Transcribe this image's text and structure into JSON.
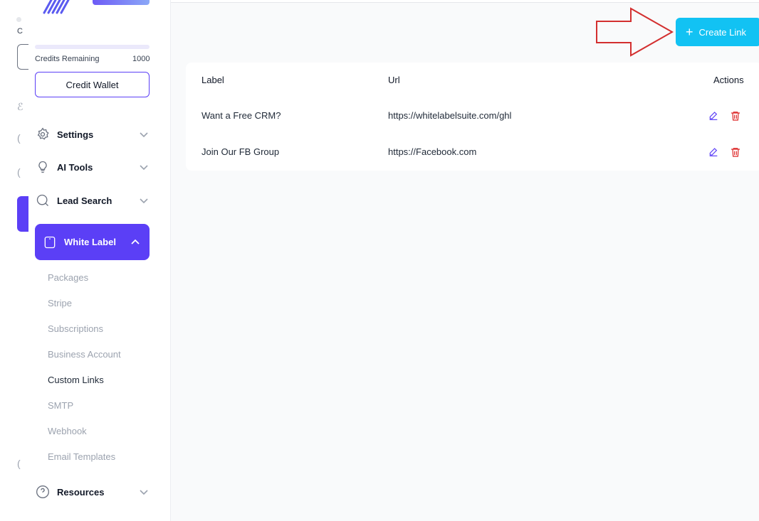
{
  "rail": {
    "letter": "C"
  },
  "sidebar": {
    "credits_label": "Credits Remaining",
    "credits_value": "1000",
    "credit_wallet_label": "Credit Wallet",
    "nav": [
      {
        "label": "Settings",
        "icon": "gear-icon"
      },
      {
        "label": "AI Tools",
        "icon": "lightbulb-icon"
      },
      {
        "label": "Lead Search",
        "icon": "search-icon"
      },
      {
        "label": "White Label",
        "icon": "tablet-icon",
        "active": true
      },
      {
        "label": "Resources",
        "icon": "help-circle-icon"
      }
    ],
    "sub_items": [
      "Packages",
      "Stripe",
      "Subscriptions",
      "Business Account",
      "Custom Links",
      "SMTP",
      "Webhook",
      "Email Templates"
    ],
    "current_sub": "Custom Links"
  },
  "main": {
    "create_button_label": "Create Link",
    "table": {
      "headers": {
        "label": "Label",
        "url": "Url",
        "actions": "Actions"
      },
      "rows": [
        {
          "label": "Want a Free CRM?",
          "url": "https://whitelabelsuite.com/ghl"
        },
        {
          "label": "Join Our FB Group",
          "url": "https://Facebook.com"
        }
      ]
    }
  },
  "colors": {
    "accent": "#5b3ff6",
    "create_button": "#12c2f3",
    "arrow": "#d32f2f",
    "delete": "#dc2626"
  }
}
